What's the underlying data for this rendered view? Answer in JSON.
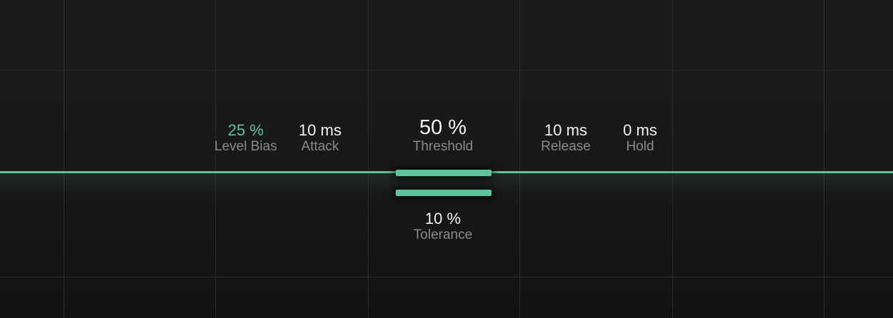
{
  "colors": {
    "accent": "#5fc49b",
    "background": "#181818",
    "grid": "#2a2a2a",
    "value_text": "#f2f2f2",
    "label_text": "#8a8a8a"
  },
  "params": {
    "level_bias": {
      "value": "25 %",
      "label": "Level Bias"
    },
    "attack": {
      "value": "10 ms",
      "label": "Attack"
    },
    "threshold": {
      "value": "50 %",
      "label": "Threshold",
      "level_percent": 50
    },
    "release": {
      "value": "10 ms",
      "label": "Release"
    },
    "hold": {
      "value": "0 ms",
      "label": "Hold"
    },
    "tolerance": {
      "value": "10 %",
      "label": "Tolerance"
    }
  }
}
